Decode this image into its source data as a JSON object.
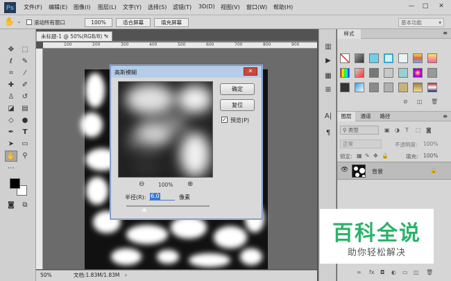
{
  "app": {
    "logo": "Ps"
  },
  "menubar": {
    "items": [
      "文件(F)",
      "编辑(E)",
      "图像(I)",
      "图层(L)",
      "文字(Y)",
      "选择(S)",
      "滤镜(T)",
      "3D(D)",
      "视图(V)",
      "窗口(W)",
      "帮助(H)"
    ],
    "window_controls": [
      "—",
      "□",
      "✕"
    ]
  },
  "options_bar": {
    "scroll_all_label": "滚动所有窗口",
    "zoom_value": "100%",
    "fit_screen_label": "适合屏幕",
    "fill_screen_label": "填充屏幕",
    "workspace": "基本功能"
  },
  "document": {
    "tab_title": "未标题-1 @ 50%(RGB/8) *",
    "ruler_h_labels": [
      "100",
      "200",
      "300",
      "400",
      "500",
      "600",
      "700",
      "800",
      "900"
    ],
    "status_zoom": "50%",
    "status_doc": "文档:1.83M/1.83M"
  },
  "dialog": {
    "title": "高斯模糊",
    "close_icon": "close-icon",
    "ok_label": "确定",
    "reset_label": "复位",
    "preview_label": "预览(P)",
    "preview_checked": true,
    "zoom_out": "⊖",
    "zoom_level": "100%",
    "zoom_in": "⊕",
    "radius_label": "半径(R):",
    "radius_value": "6.0",
    "radius_unit": "像素",
    "radius_slider_fraction": 0.22
  },
  "panels": {
    "styles_tab": "样式",
    "layers_tabs": [
      "图层",
      "通道",
      "路径"
    ],
    "kind_filter": "类型",
    "blend_mode": "正常",
    "opacity_label": "不透明度:",
    "opacity_value": "100%",
    "lock_label": "锁定:",
    "fill_label": "填充:",
    "fill_value": "100%",
    "layer_name": "背景"
  },
  "watermark": {
    "title": "百科全说",
    "subtitle": "助你轻松解决"
  },
  "colors": {
    "foreground": "#000000",
    "background": "#ffffff",
    "watermark_green": "#2bb36a",
    "dialog_titlebar": "#b5cde9"
  }
}
